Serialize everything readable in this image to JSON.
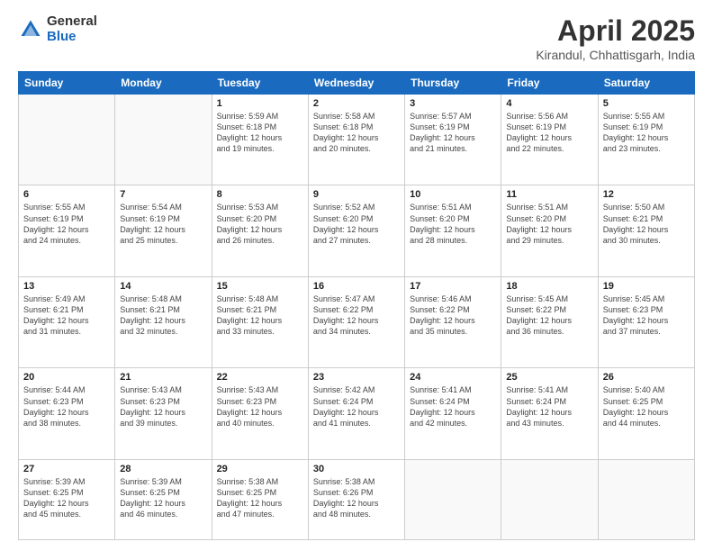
{
  "header": {
    "logo_general": "General",
    "logo_blue": "Blue",
    "month": "April 2025",
    "location": "Kirandul, Chhattisgarh, India"
  },
  "weekdays": [
    "Sunday",
    "Monday",
    "Tuesday",
    "Wednesday",
    "Thursday",
    "Friday",
    "Saturday"
  ],
  "weeks": [
    [
      {
        "day": "",
        "info": ""
      },
      {
        "day": "",
        "info": ""
      },
      {
        "day": "1",
        "info": "Sunrise: 5:59 AM\nSunset: 6:18 PM\nDaylight: 12 hours\nand 19 minutes."
      },
      {
        "day": "2",
        "info": "Sunrise: 5:58 AM\nSunset: 6:18 PM\nDaylight: 12 hours\nand 20 minutes."
      },
      {
        "day": "3",
        "info": "Sunrise: 5:57 AM\nSunset: 6:19 PM\nDaylight: 12 hours\nand 21 minutes."
      },
      {
        "day": "4",
        "info": "Sunrise: 5:56 AM\nSunset: 6:19 PM\nDaylight: 12 hours\nand 22 minutes."
      },
      {
        "day": "5",
        "info": "Sunrise: 5:55 AM\nSunset: 6:19 PM\nDaylight: 12 hours\nand 23 minutes."
      }
    ],
    [
      {
        "day": "6",
        "info": "Sunrise: 5:55 AM\nSunset: 6:19 PM\nDaylight: 12 hours\nand 24 minutes."
      },
      {
        "day": "7",
        "info": "Sunrise: 5:54 AM\nSunset: 6:19 PM\nDaylight: 12 hours\nand 25 minutes."
      },
      {
        "day": "8",
        "info": "Sunrise: 5:53 AM\nSunset: 6:20 PM\nDaylight: 12 hours\nand 26 minutes."
      },
      {
        "day": "9",
        "info": "Sunrise: 5:52 AM\nSunset: 6:20 PM\nDaylight: 12 hours\nand 27 minutes."
      },
      {
        "day": "10",
        "info": "Sunrise: 5:51 AM\nSunset: 6:20 PM\nDaylight: 12 hours\nand 28 minutes."
      },
      {
        "day": "11",
        "info": "Sunrise: 5:51 AM\nSunset: 6:20 PM\nDaylight: 12 hours\nand 29 minutes."
      },
      {
        "day": "12",
        "info": "Sunrise: 5:50 AM\nSunset: 6:21 PM\nDaylight: 12 hours\nand 30 minutes."
      }
    ],
    [
      {
        "day": "13",
        "info": "Sunrise: 5:49 AM\nSunset: 6:21 PM\nDaylight: 12 hours\nand 31 minutes."
      },
      {
        "day": "14",
        "info": "Sunrise: 5:48 AM\nSunset: 6:21 PM\nDaylight: 12 hours\nand 32 minutes."
      },
      {
        "day": "15",
        "info": "Sunrise: 5:48 AM\nSunset: 6:21 PM\nDaylight: 12 hours\nand 33 minutes."
      },
      {
        "day": "16",
        "info": "Sunrise: 5:47 AM\nSunset: 6:22 PM\nDaylight: 12 hours\nand 34 minutes."
      },
      {
        "day": "17",
        "info": "Sunrise: 5:46 AM\nSunset: 6:22 PM\nDaylight: 12 hours\nand 35 minutes."
      },
      {
        "day": "18",
        "info": "Sunrise: 5:45 AM\nSunset: 6:22 PM\nDaylight: 12 hours\nand 36 minutes."
      },
      {
        "day": "19",
        "info": "Sunrise: 5:45 AM\nSunset: 6:23 PM\nDaylight: 12 hours\nand 37 minutes."
      }
    ],
    [
      {
        "day": "20",
        "info": "Sunrise: 5:44 AM\nSunset: 6:23 PM\nDaylight: 12 hours\nand 38 minutes."
      },
      {
        "day": "21",
        "info": "Sunrise: 5:43 AM\nSunset: 6:23 PM\nDaylight: 12 hours\nand 39 minutes."
      },
      {
        "day": "22",
        "info": "Sunrise: 5:43 AM\nSunset: 6:23 PM\nDaylight: 12 hours\nand 40 minutes."
      },
      {
        "day": "23",
        "info": "Sunrise: 5:42 AM\nSunset: 6:24 PM\nDaylight: 12 hours\nand 41 minutes."
      },
      {
        "day": "24",
        "info": "Sunrise: 5:41 AM\nSunset: 6:24 PM\nDaylight: 12 hours\nand 42 minutes."
      },
      {
        "day": "25",
        "info": "Sunrise: 5:41 AM\nSunset: 6:24 PM\nDaylight: 12 hours\nand 43 minutes."
      },
      {
        "day": "26",
        "info": "Sunrise: 5:40 AM\nSunset: 6:25 PM\nDaylight: 12 hours\nand 44 minutes."
      }
    ],
    [
      {
        "day": "27",
        "info": "Sunrise: 5:39 AM\nSunset: 6:25 PM\nDaylight: 12 hours\nand 45 minutes."
      },
      {
        "day": "28",
        "info": "Sunrise: 5:39 AM\nSunset: 6:25 PM\nDaylight: 12 hours\nand 46 minutes."
      },
      {
        "day": "29",
        "info": "Sunrise: 5:38 AM\nSunset: 6:25 PM\nDaylight: 12 hours\nand 47 minutes."
      },
      {
        "day": "30",
        "info": "Sunrise: 5:38 AM\nSunset: 6:26 PM\nDaylight: 12 hours\nand 48 minutes."
      },
      {
        "day": "",
        "info": ""
      },
      {
        "day": "",
        "info": ""
      },
      {
        "day": "",
        "info": ""
      }
    ]
  ]
}
